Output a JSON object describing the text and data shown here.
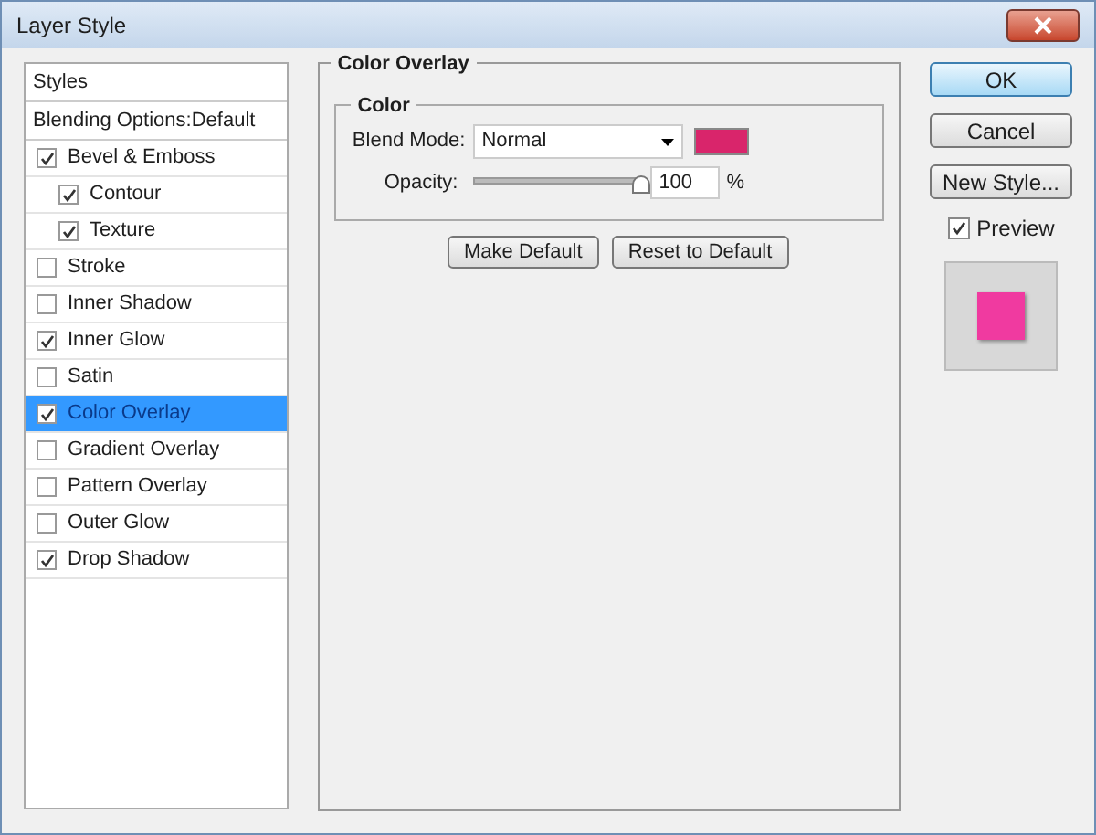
{
  "window": {
    "title": "Layer Style"
  },
  "sidebar": {
    "items": [
      {
        "kind": "header",
        "label": "Styles",
        "selected": false
      },
      {
        "kind": "header",
        "label": "Blending Options:Default",
        "selected": false
      },
      {
        "kind": "effect",
        "label": "Bevel & Emboss",
        "checked": true,
        "selected": false,
        "children": [
          {
            "kind": "effect",
            "label": "Contour",
            "checked": true,
            "selected": false
          },
          {
            "kind": "effect",
            "label": "Texture",
            "checked": true,
            "selected": false
          }
        ]
      },
      {
        "kind": "effect",
        "label": "Stroke",
        "checked": false,
        "selected": false
      },
      {
        "kind": "effect",
        "label": "Inner Shadow",
        "checked": false,
        "selected": false
      },
      {
        "kind": "effect",
        "label": "Inner Glow",
        "checked": true,
        "selected": false
      },
      {
        "kind": "effect",
        "label": "Satin",
        "checked": false,
        "selected": false
      },
      {
        "kind": "effect",
        "label": "Color Overlay",
        "checked": true,
        "selected": true
      },
      {
        "kind": "effect",
        "label": "Gradient Overlay",
        "checked": false,
        "selected": false
      },
      {
        "kind": "effect",
        "label": "Pattern Overlay",
        "checked": false,
        "selected": false
      },
      {
        "kind": "effect",
        "label": "Outer Glow",
        "checked": false,
        "selected": false
      },
      {
        "kind": "effect",
        "label": "Drop Shadow",
        "checked": true,
        "selected": false
      }
    ]
  },
  "panel": {
    "title": "Color Overlay",
    "group": "Color",
    "blend_mode": {
      "label": "Blend Mode:",
      "value": "Normal",
      "color": "#d9256b"
    },
    "opacity": {
      "label": "Opacity:",
      "level": 0.97,
      "value": "100",
      "unit": "%"
    },
    "buttons": [
      "Make Default",
      "Reset to Default"
    ]
  },
  "actions": [
    {
      "label": "OK",
      "default": true
    },
    {
      "label": "Cancel",
      "default": false
    },
    {
      "label": "New Style...",
      "default": false
    }
  ],
  "preview": {
    "label": "Preview",
    "checked": true,
    "color": "#f03aa0"
  }
}
